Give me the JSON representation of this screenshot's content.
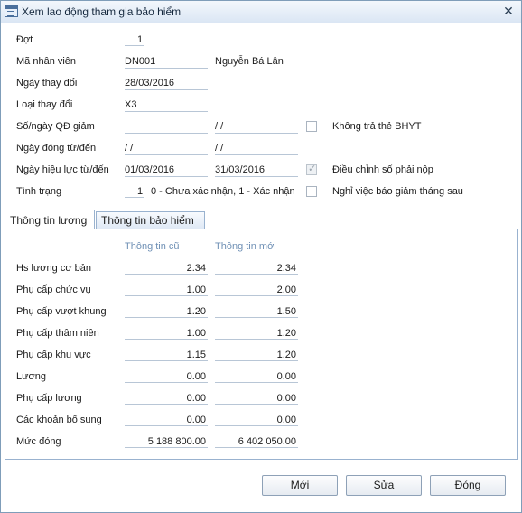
{
  "window": {
    "title": "Xem lao động tham gia bảo hiểm",
    "close_glyph": "✕"
  },
  "form": {
    "dot": {
      "label": "Đợt",
      "value": "1"
    },
    "ma_nhan_vien": {
      "label": "Mã nhân viên",
      "value": "DN001",
      "name": "Nguyễn Bá Lân"
    },
    "ngay_thay_doi": {
      "label": "Ngày thay đổi",
      "value": "28/03/2016"
    },
    "loai_thay_doi": {
      "label": "Loại thay đổi",
      "value": "X3"
    },
    "so_ngay_qd_giam": {
      "label": "Số/ngày QĐ giảm",
      "so": "",
      "ngay": " /  /"
    },
    "ngay_dong": {
      "label": "Ngày đóng từ/đến",
      "tu": " /  /",
      "den": " /  /"
    },
    "ngay_hieu_luc": {
      "label": "Ngày hiệu lực từ/đến",
      "tu": "01/03/2016",
      "den": "31/03/2016"
    },
    "tinh_trang": {
      "label": "Tình trạng",
      "value": "1",
      "hint": "0 - Chưa xác nhận, 1 - Xác nhận"
    },
    "checkboxes": {
      "khong_tra_the": {
        "label": "Không trả thẻ BHYT",
        "checked": false
      },
      "dieu_chinh_so": {
        "label": "Điều chỉnh số phải nộp",
        "checked": true
      },
      "nghi_viec": {
        "label": "Nghỉ việc báo giảm tháng sau",
        "checked": false
      }
    }
  },
  "tabs": [
    {
      "label": "Thông tin lương",
      "active": true
    },
    {
      "label": "Thông tin bảo hiểm",
      "active": false
    }
  ],
  "salary": {
    "col_old": "Thông tin cũ",
    "col_new": "Thông tin mới",
    "rows": [
      {
        "label": "Hs lương cơ bản",
        "old": "2.34",
        "new": "2.34"
      },
      {
        "label": "Phụ cấp chức vụ",
        "old": "1.00",
        "new": "2.00"
      },
      {
        "label": "Phụ cấp vượt khung",
        "old": "1.20",
        "new": "1.50"
      },
      {
        "label": "Phụ cấp thâm niên",
        "old": "1.00",
        "new": "1.20"
      },
      {
        "label": "Phụ cấp khu vực",
        "old": "1.15",
        "new": "1.20"
      },
      {
        "label": "Lương",
        "old": "0.00",
        "new": "0.00"
      },
      {
        "label": "Phụ cấp lương",
        "old": "0.00",
        "new": "0.00"
      },
      {
        "label": "Các khoản bổ sung",
        "old": "0.00",
        "new": "0.00"
      },
      {
        "label": "Mức đóng",
        "old": "5 188 800.00",
        "new": "6 402 050.00"
      }
    ]
  },
  "buttons": {
    "moi": {
      "label": "Mới",
      "mnemonic": "M",
      "rest": "ới"
    },
    "sua": {
      "label": "Sửa",
      "mnemonic": "S",
      "rest": "ửa"
    },
    "dong": {
      "label": "Đóng"
    }
  }
}
